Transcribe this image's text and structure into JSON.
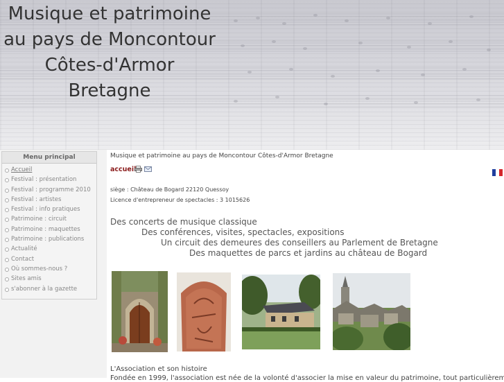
{
  "header": {
    "title_lines": [
      "Musique et patrimoine",
      "au pays de Moncontour",
      "Côtes-d'Armor",
      "Bretagne"
    ]
  },
  "sidebar": {
    "menu_title": "Menu principal",
    "items": [
      {
        "label": "Accueil",
        "active": true
      },
      {
        "label": "Festival : présentation"
      },
      {
        "label": "Festival : programme 2010"
      },
      {
        "label": "Festival : artistes"
      },
      {
        "label": "Festival : info pratiques"
      },
      {
        "label": "Patrimoine : circuit"
      },
      {
        "label": "Patrimoine : maquettes"
      },
      {
        "label": "Patrimoine : publications"
      },
      {
        "label": "Actualité"
      },
      {
        "label": "Contact"
      },
      {
        "label": "Où sommes-nous ?"
      },
      {
        "label": "Sites amis"
      },
      {
        "label": "s'abonner à la gazette"
      }
    ]
  },
  "main": {
    "breadcrumb": "Musique et patrimoine au pays de Moncontour Côtes-d'Armor Bretagne",
    "heading": "accueil",
    "icons": [
      "print-icon",
      "email-icon",
      "french-flag-icon"
    ],
    "seat": "siège : Château de Bogard 22120 Quessoy",
    "licence": "Licence d'entrepreneur de spectacles : 3 1015626",
    "taglines": [
      "Des concerts de musique classique",
      "Des conférences, visites, spectacles, expositions",
      "Un circuit des demeures des conseillers au Parlement de Bretagne",
      "Des maquettes de parcs et jardins au château de Bogard"
    ],
    "association_title": "L'Association et son histoire",
    "association_text": "Fondée en 1999, l'association est née de la volonté d'associer la mise en valeur du patrimoine, tout particulièrement les"
  },
  "colors": {
    "heading": "#8b1c1c",
    "sidebar_bg": "#f2f2f2",
    "menu_text": "#888888"
  }
}
